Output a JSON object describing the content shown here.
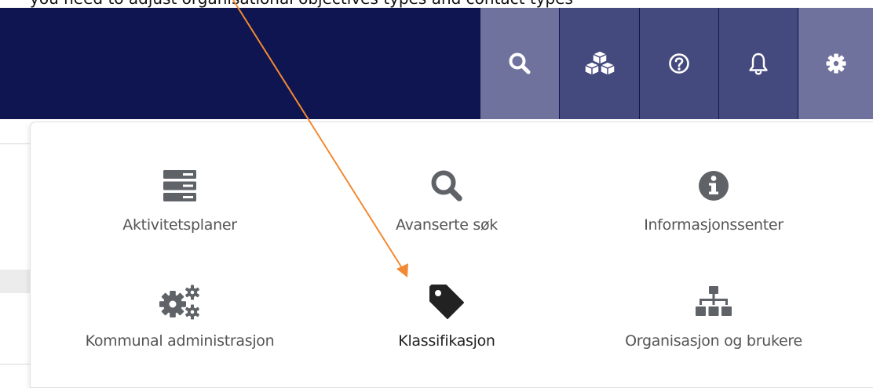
{
  "caption": {
    "text": "you need to adjust organisational objectives types and contact types"
  },
  "header": {
    "buttons": [
      {
        "name": "search",
        "icon": "search-icon"
      },
      {
        "name": "apps",
        "icon": "cubes-icon"
      },
      {
        "name": "help",
        "icon": "help-circle-icon"
      },
      {
        "name": "notifications",
        "icon": "bell-icon"
      },
      {
        "name": "settings",
        "icon": "gear-icon"
      }
    ],
    "colors": {
      "bar": "#0f1550",
      "button_light": "#6f729c",
      "button_dark": "#454a7e"
    }
  },
  "menu": {
    "items": [
      {
        "label": "Aktivitetsplaner",
        "icon": "server-stack-icon"
      },
      {
        "label": "Avanserte søk",
        "icon": "search-icon"
      },
      {
        "label": "Informasjonssenter",
        "icon": "info-circle-icon"
      },
      {
        "label": "Kommunal administrasjon",
        "icon": "gears-icon"
      },
      {
        "label": "Klassifikasjon",
        "icon": "tag-icon",
        "active": true
      },
      {
        "label": "Organisasjon og brukere",
        "icon": "sitemap-icon"
      }
    ],
    "icon_color": "#5f6368",
    "active_icon_color": "#222222"
  },
  "annotation": {
    "arrow_color": "#f28a33",
    "target": "Klassifikasjon"
  }
}
